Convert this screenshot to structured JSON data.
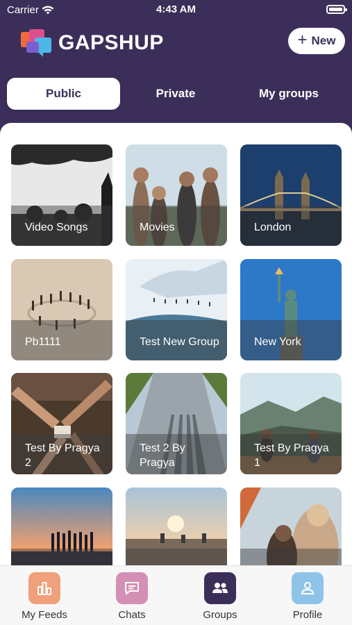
{
  "status_bar": {
    "carrier": "Carrier",
    "time": "4:43 AM"
  },
  "app": {
    "name": "GAPSHUP",
    "new_label": "New"
  },
  "tabs": [
    {
      "label": "Public",
      "active": true
    },
    {
      "label": "Private",
      "active": false
    },
    {
      "label": "My groups",
      "active": false
    }
  ],
  "groups": [
    {
      "title": "Video Songs",
      "theme": "concert"
    },
    {
      "title": "Movies",
      "theme": "friends"
    },
    {
      "title": "London",
      "theme": "london"
    },
    {
      "title": "Pb1111",
      "theme": "beach-people"
    },
    {
      "title": "Test New Group",
      "theme": "snow"
    },
    {
      "title": "New York",
      "theme": "liberty"
    },
    {
      "title": "Test By Pragya 2",
      "theme": "hands"
    },
    {
      "title": "Test 2 By Pragya",
      "theme": "road"
    },
    {
      "title": "Test By Pragya 1",
      "theme": "mountains"
    },
    {
      "title": "",
      "theme": "sunset-crowd"
    },
    {
      "title": "",
      "theme": "sunrise"
    },
    {
      "title": "",
      "theme": "festival"
    }
  ],
  "bottom_nav": [
    {
      "label": "My Feeds",
      "icon": "bar-chart-icon",
      "color": "#f0a07a"
    },
    {
      "label": "Chats",
      "icon": "chat-icon",
      "color": "#d48fb4"
    },
    {
      "label": "Groups",
      "icon": "group-icon",
      "color": "#3b2f5a",
      "active": true
    },
    {
      "label": "Profile",
      "icon": "person-icon",
      "color": "#8fc4e8"
    }
  ],
  "colors": {
    "header": "#3b2f5a",
    "accent_orange": "#f0a07a"
  }
}
